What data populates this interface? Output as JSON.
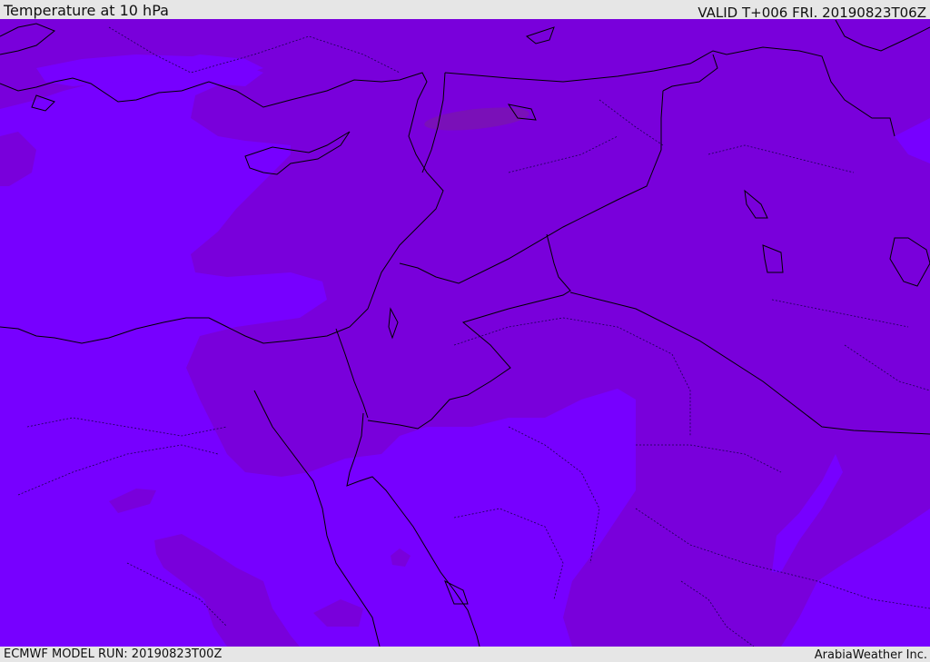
{
  "header": {
    "title": "Temperature at 10 hPa",
    "valid_time": "VALID T+006 FRI. 20190823T06Z"
  },
  "footer": {
    "model_run": "ECMWF MODEL RUN: 20190823T00Z",
    "credit": "ArabiaWeather Inc."
  },
  "map": {
    "colors": {
      "warmer_band": "#7900db",
      "cooler_band": "#7700ff",
      "warmest_patch": "#7a10b8",
      "coastline": "#000000",
      "border_dotted": "#1a0050"
    }
  }
}
